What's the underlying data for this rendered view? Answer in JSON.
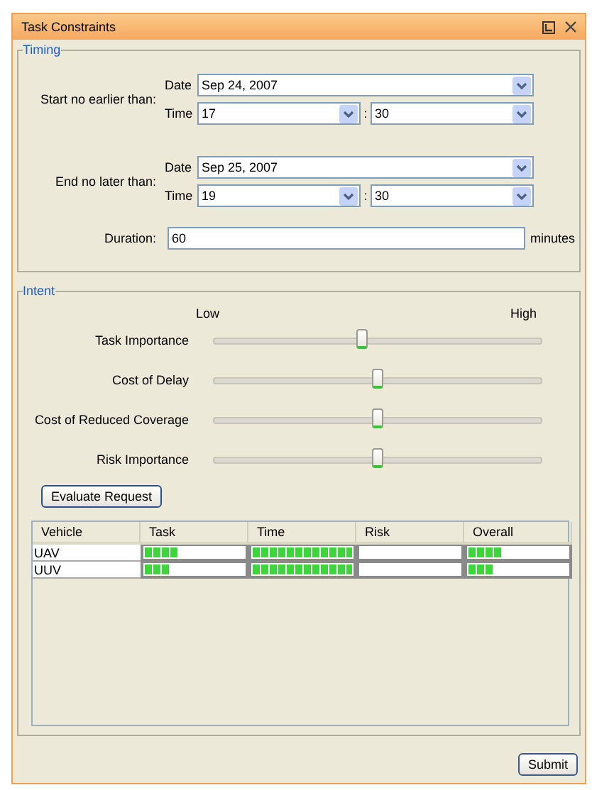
{
  "window": {
    "title": "Task Constraints"
  },
  "timing": {
    "title": "Timing",
    "constraints": [
      {
        "label": "Start no earlier than:",
        "date_label": "Date",
        "date": "Sep 24, 2007",
        "time_label": "Time",
        "hour": "17",
        "separator": ":",
        "minute": "30"
      },
      {
        "label": "End no later than:",
        "date_label": "Date",
        "date": "Sep 25, 2007",
        "time_label": "Time",
        "hour": "19",
        "separator": ":",
        "minute": "30"
      }
    ],
    "duration": {
      "label": "Duration:",
      "value": "60",
      "unit": "minutes"
    }
  },
  "intent": {
    "title": "Intent",
    "scale": {
      "low": "Low",
      "high": "High"
    },
    "sliders": [
      {
        "label": "Task Importance",
        "level": 0.45
      },
      {
        "label": "Cost of Delay",
        "level": 0.5
      },
      {
        "label": "Cost of Reduced Coverage",
        "level": 0.5
      },
      {
        "label": "Risk Importance",
        "level": 0.5
      }
    ],
    "evaluate_button": "Evaluate Request",
    "table": {
      "columns": [
        "Vehicle",
        "Task",
        "Time",
        "Risk",
        "Overall"
      ],
      "rows": [
        {
          "vehicle": "UAV",
          "scores": [
            {
              "kind": "meter",
              "level": 0.33
            },
            {
              "kind": "meter",
              "level": 1.0
            },
            {
              "kind": "empty"
            },
            {
              "kind": "meter",
              "level": 0.33
            }
          ]
        },
        {
          "vehicle": "UUV",
          "scores": [
            {
              "kind": "meter",
              "level": 0.25
            },
            {
              "kind": "meter",
              "level": 1.0
            },
            {
              "kind": "empty"
            },
            {
              "kind": "meter",
              "level": 0.25
            }
          ]
        }
      ]
    }
  },
  "submit_button": "Submit"
}
